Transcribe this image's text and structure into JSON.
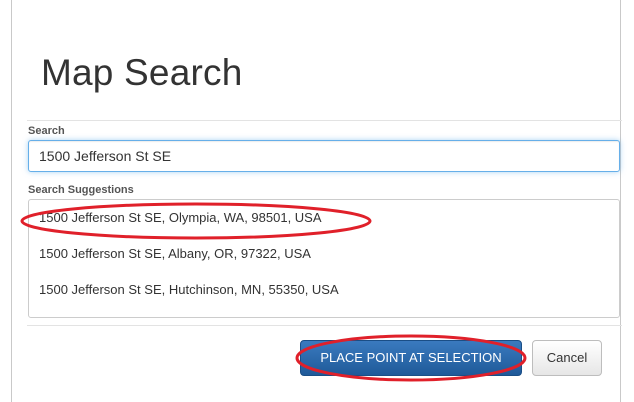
{
  "dialog": {
    "title": "Map Search"
  },
  "search": {
    "label": "Search",
    "value": "1500 Jefferson St SE"
  },
  "suggestions": {
    "label": "Search Suggestions",
    "items": [
      "1500 Jefferson St SE, Olympia, WA, 98501, USA",
      "1500 Jefferson St SE, Albany, OR, 97322, USA",
      "1500 Jefferson St SE, Hutchinson, MN, 55350, USA"
    ]
  },
  "buttons": {
    "place_point_label": "PLACE POINT AT SELECTION",
    "cancel_label": "Cancel"
  },
  "colors": {
    "primary": "#2a69ac",
    "annotation": "#e0202a",
    "focus": "#66afe9"
  }
}
